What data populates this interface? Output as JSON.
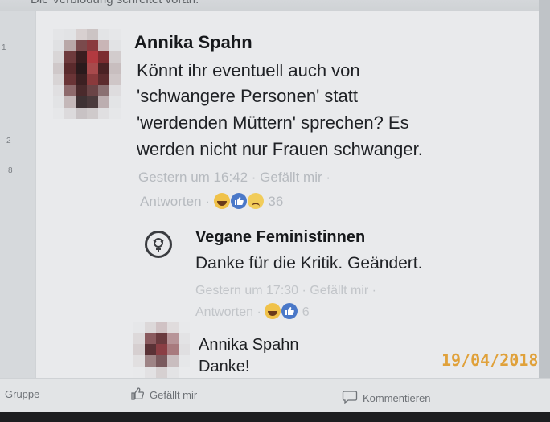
{
  "header_snippet": "Die Verblödung schreitet voran.",
  "sidebar_numbers": [
    "1",
    "2",
    "8"
  ],
  "comment_1": {
    "author": "Annika Spahn",
    "text_lines": [
      "Könnt ihr eventuell auch von",
      "'schwangere Personen' statt",
      "'werdenden Müttern' sprechen? Es",
      "werden nicht nur Frauen schwanger."
    ],
    "meta_line1": "Gestern um 16:42 · Gefällt mir ·",
    "meta_line2_prefix": "Antworten ·",
    "reaction_count": "36"
  },
  "reply_1": {
    "author": "Vegane Feministinnen",
    "text": "Danke für die Kritik. Geändert.",
    "meta_line1": "Gestern um 17:30 · Gefällt mir ·",
    "meta_line2_prefix": "Antworten ·",
    "reaction_count": "6"
  },
  "reply_2": {
    "author": "Annika Spahn",
    "text": "Danke!"
  },
  "bottom_bar": {
    "group_label": "Gruppe",
    "like_label": "Gefällt mir",
    "comment_label": "Kommentieren"
  },
  "date_stamp": "19/04/2018",
  "colors": {
    "stamp": "#e0a13a",
    "like_blue": "#4a78c8",
    "haha_yellow": "#f0c24a"
  }
}
